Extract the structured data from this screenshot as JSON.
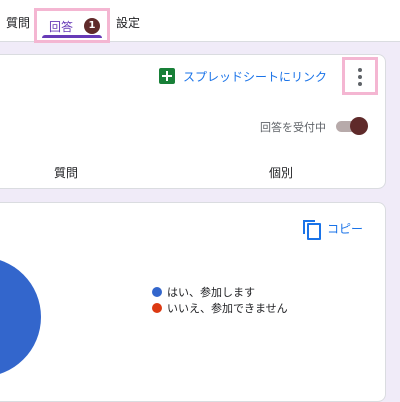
{
  "tabs": {
    "questions": "質問",
    "responses": "回答",
    "responses_badge": "1",
    "settings": "設定"
  },
  "summary_card": {
    "sheet_link": "スプレッドシートにリンク",
    "accepting_label": "回答を受付中",
    "accepting_on": true,
    "subtabs": [
      "質問",
      "個別"
    ]
  },
  "chart_card": {
    "copy_label": "コピー",
    "colors": {
      "yes": "#3366cc",
      "no": "#dc3912"
    }
  },
  "chart_data": {
    "type": "pie",
    "categories": [
      "はい、参加します",
      "いいえ、参加できません"
    ],
    "values": [
      1,
      0
    ],
    "title": "",
    "legend": "right"
  }
}
